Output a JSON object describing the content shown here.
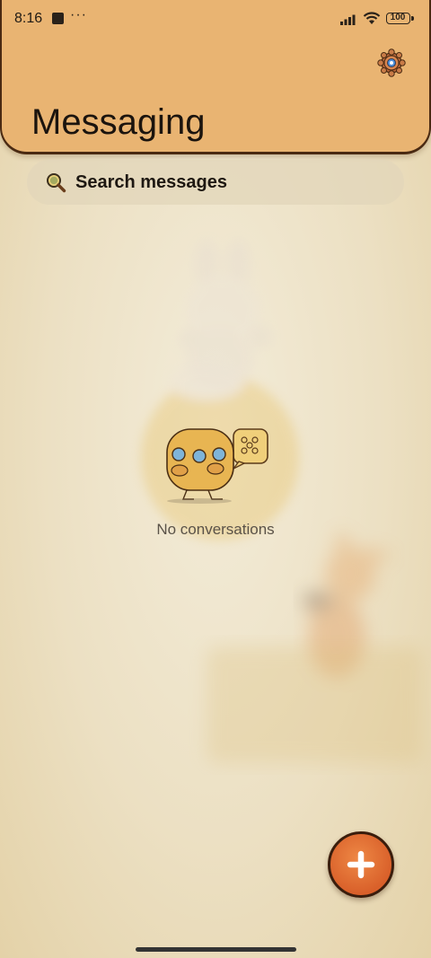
{
  "status_bar": {
    "time": "8:16",
    "battery": "100",
    "icons": [
      "notification-square-icon",
      "more-dots-icon",
      "signal-icon",
      "wifi-icon",
      "battery-icon"
    ]
  },
  "header": {
    "title": "Messaging",
    "settings_icon": "gear-icon"
  },
  "search": {
    "placeholder": "Search messages",
    "icon": "search-icon"
  },
  "empty_state": {
    "text": "No conversations",
    "illustration": "chat-mascot-icon"
  },
  "fab": {
    "icon": "plus-icon"
  },
  "colors": {
    "header": "#e9b472",
    "header_border": "#4a2a12",
    "background": "#ece0c3",
    "fab": "#e07232",
    "text": "#1b140e"
  }
}
